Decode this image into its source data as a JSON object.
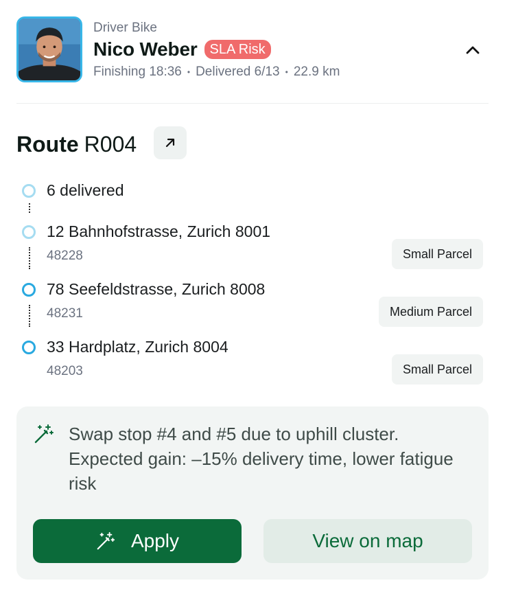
{
  "driver": {
    "role": "Driver Bike",
    "name": "Nico Weber",
    "badge": "SLA Risk",
    "finishing": "Finishing 18:36",
    "delivered": "Delivered 6/13",
    "distance": "22.9 km",
    "separator": "•"
  },
  "route": {
    "label": "Route",
    "id": "R004",
    "delivered_summary": "6 delivered",
    "stops": [
      {
        "address": "12 Bahnhofstrasse, Zurich 8001",
        "code": "48228",
        "parcel": "Small Parcel"
      },
      {
        "address": "78 Seefeldstrasse, Zurich 8008",
        "code": "48231",
        "parcel": "Medium Parcel"
      },
      {
        "address": "33 Hardplatz, Zurich 8004",
        "code": "48203",
        "parcel": "Small Parcel"
      }
    ]
  },
  "suggestion": {
    "text": "Swap stop #4 and #5 due to uphill cluster. Expected gain: –15% delivery time, lower fatigue risk",
    "apply_label": "Apply",
    "map_label": "View on map"
  },
  "colors": {
    "accent_green": "#0b6b3a",
    "badge_red": "#f06b6b",
    "timeline_blue": "#29a9e0",
    "timeline_light_blue": "#a5dcf1"
  },
  "icons": {
    "collapse": "chevron-up-icon",
    "route_link": "arrow-up-right-icon",
    "suggestion": "magic-wand-icon"
  }
}
